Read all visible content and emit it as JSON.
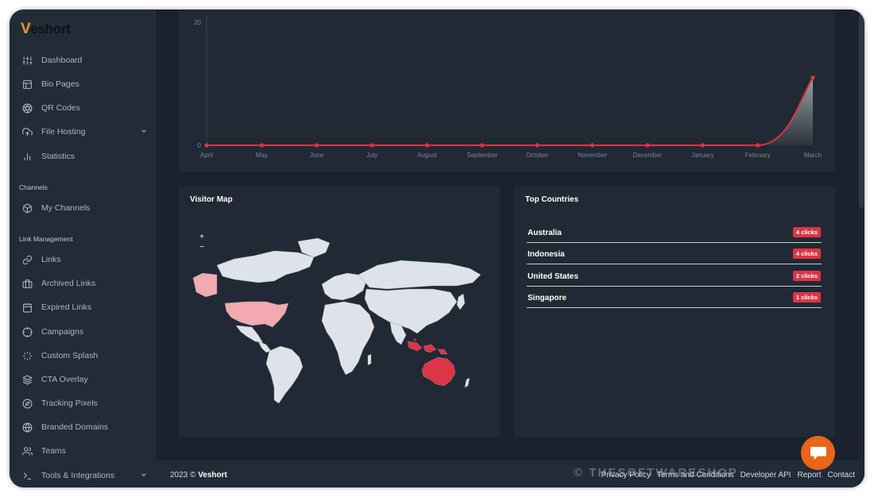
{
  "app": {
    "logo_v": "V",
    "logo_rest": "eshort"
  },
  "sidebar": {
    "items": [
      {
        "label": "Dashboard",
        "icon": "sliders-icon"
      },
      {
        "label": "Bio Pages",
        "icon": "layout-icon"
      },
      {
        "label": "QR Codes",
        "icon": "aperture-icon"
      },
      {
        "label": "File Hosting",
        "icon": "upload-cloud-icon",
        "has_chevron": true
      },
      {
        "label": "Statistics",
        "icon": "bar-chart-icon"
      }
    ],
    "channels_title": "Channels",
    "channels_items": [
      {
        "label": "My Channels",
        "icon": "box-icon"
      }
    ],
    "link_title": "Link Management",
    "link_items": [
      {
        "label": "Links",
        "icon": "link-icon"
      },
      {
        "label": "Archived Links",
        "icon": "briefcase-icon"
      },
      {
        "label": "Expired Links",
        "icon": "calendar-icon"
      },
      {
        "label": "Campaigns",
        "icon": "crosshair-icon"
      },
      {
        "label": "Custom Splash",
        "icon": "loader-icon"
      },
      {
        "label": "CTA Overlay",
        "icon": "layers-icon"
      },
      {
        "label": "Tracking Pixels",
        "icon": "compass-icon"
      },
      {
        "label": "Branded Domains",
        "icon": "globe-icon"
      },
      {
        "label": "Teams",
        "icon": "users-icon"
      },
      {
        "label": "Tools & Integrations",
        "icon": "terminal-icon",
        "has_chevron": true
      }
    ]
  },
  "chart_data": {
    "type": "area",
    "categories": [
      "April",
      "May",
      "June",
      "July",
      "August",
      "September",
      "October",
      "November",
      "December",
      "January",
      "February",
      "March"
    ],
    "series": [
      {
        "values": [
          0,
          0,
          0,
          0,
          0,
          0,
          0,
          0,
          0,
          0,
          0,
          11
        ]
      }
    ],
    "yticks": [
      "20",
      "0"
    ],
    "ylim": [
      0,
      20
    ],
    "line_color": "#dc3545"
  },
  "visitor_map": {
    "title": "Visitor Map",
    "zoom_in": "+",
    "zoom_out": "−",
    "highlight_colors": {
      "high": "#dc3545",
      "low": "#f3a9b0",
      "none": "#dfe3e9"
    }
  },
  "top_countries": {
    "title": "Top Countries",
    "rows": [
      {
        "country": "Australia",
        "clicks": "4 clicks"
      },
      {
        "country": "Indonesia",
        "clicks": "4 clicks"
      },
      {
        "country": "United States",
        "clicks": "2 clicks"
      },
      {
        "country": "Singapore",
        "clicks": "1 clicks"
      }
    ]
  },
  "footer": {
    "year": "2023 ©",
    "brand": "Veshort",
    "links": [
      "Privacy Policy",
      "Terms and Conditions",
      "Developer API",
      "Report",
      "Contact"
    ]
  },
  "watermark": "© THESOFTWARESHOP"
}
